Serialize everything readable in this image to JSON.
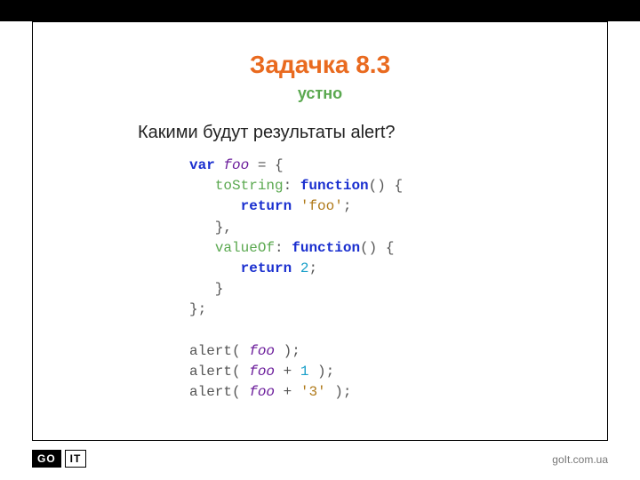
{
  "title": "Задачка 8.3",
  "subtitle": "устно",
  "question": "Какими будут результаты alert?",
  "code": {
    "l1_kw": "var",
    "l1_ident": "foo",
    "l1_rest": " = {",
    "l2_prop": "toString",
    "l2_mid": ": ",
    "l2_fn": "function",
    "l2_rest": "() {",
    "l3_kw": "return",
    "l3_str": "'foo'",
    "l3_rest": ";",
    "l4": "   },",
    "l5_prop": "valueOf",
    "l5_mid": ": ",
    "l5_fn": "function",
    "l5_rest": "() {",
    "l6_kw": "return",
    "l6_num": "2",
    "l6_rest": ";",
    "l7": "   }",
    "l8": "};",
    "l10_call": "alert( ",
    "l10_ident": "foo",
    "l10_rest": " );",
    "l11_call": "alert( ",
    "l11_ident": "foo",
    "l11_mid": " + ",
    "l11_num": "1",
    "l11_rest": " );",
    "l12_call": "alert( ",
    "l12_ident": "foo",
    "l12_mid": " + ",
    "l12_str": "'3'",
    "l12_rest": " );"
  },
  "logo_go": "GO",
  "logo_it": "IT",
  "url": "goIt.com.ua"
}
